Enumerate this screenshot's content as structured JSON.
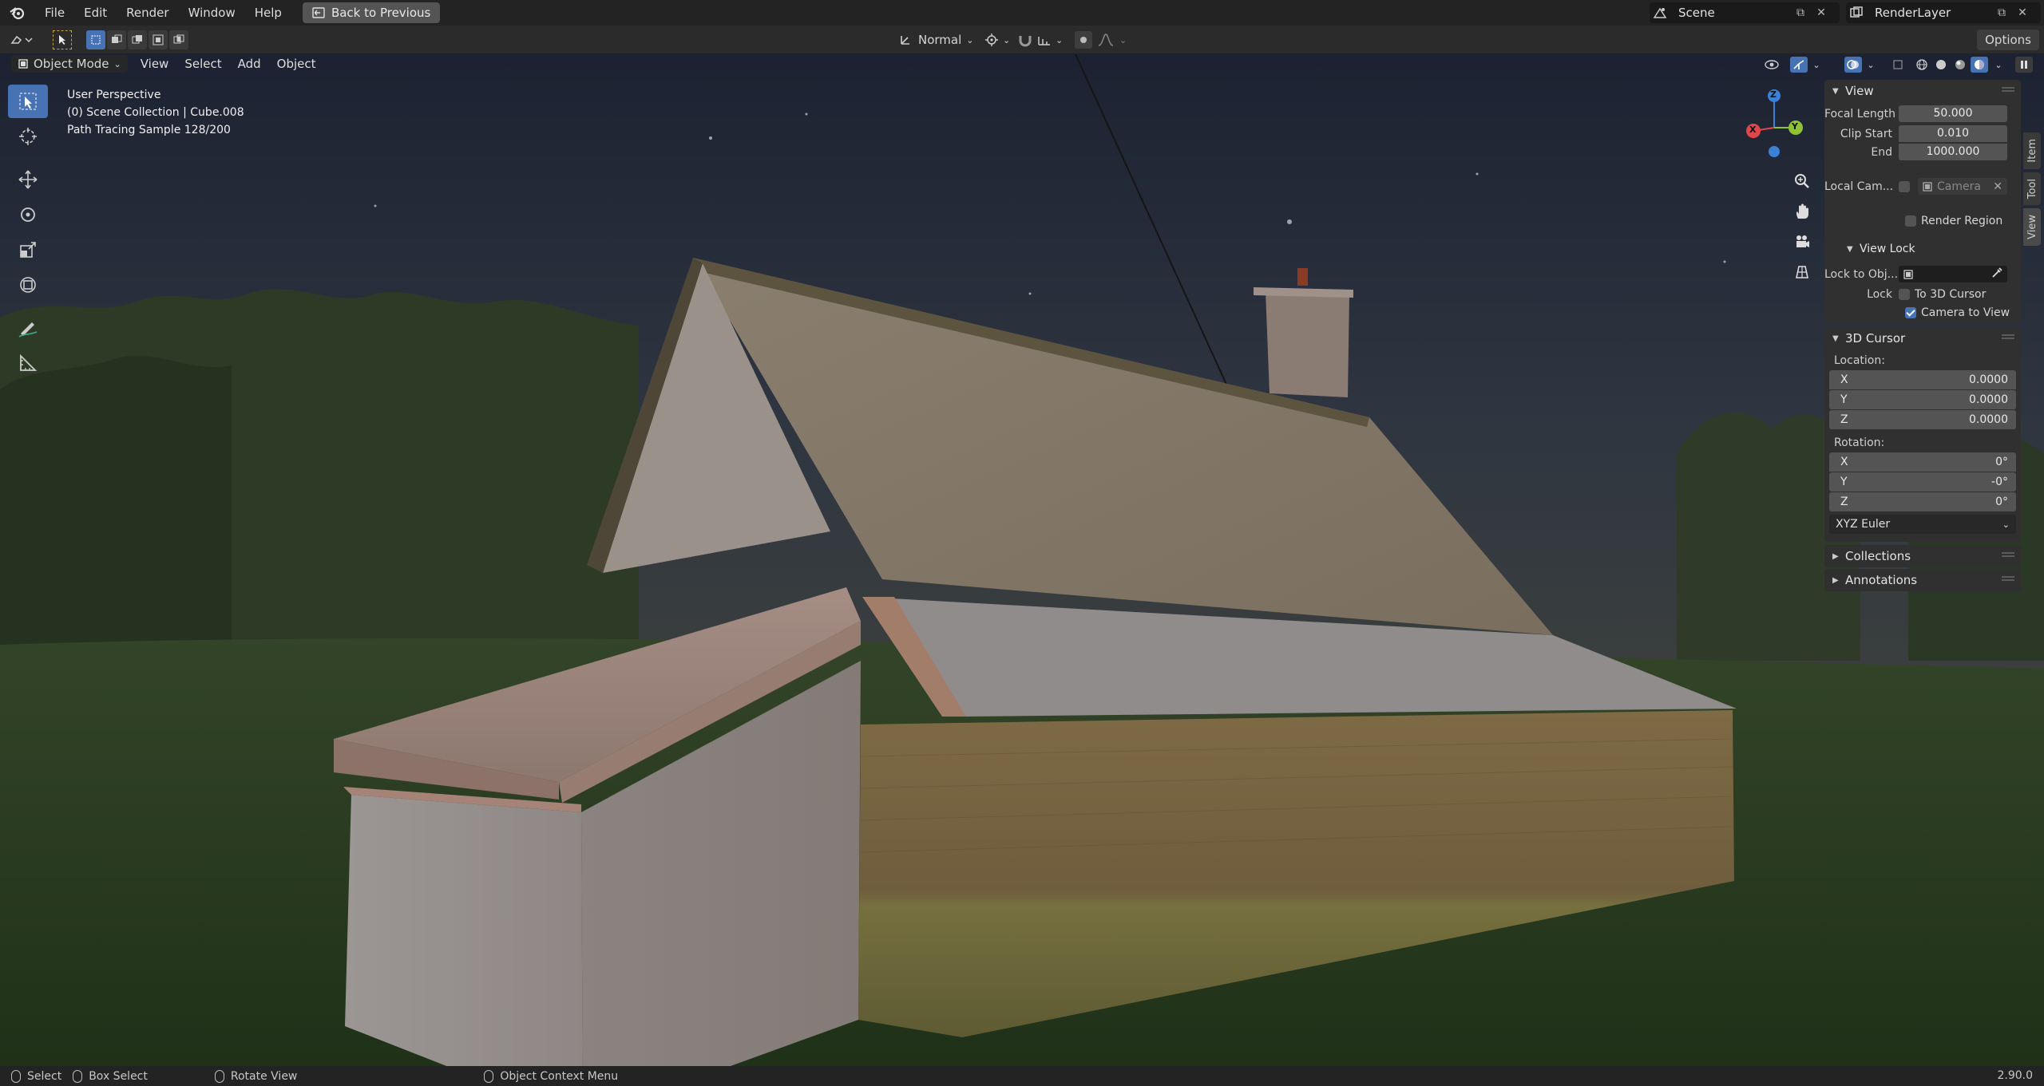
{
  "menubar": {
    "items": [
      "File",
      "Edit",
      "Render",
      "Window",
      "Help"
    ],
    "back_button": "Back to Previous",
    "scene_name": "Scene",
    "view_layer": "RenderLayer"
  },
  "tool_header": {
    "transform_orientation": "Normal",
    "options_label": "Options"
  },
  "viewport_header": {
    "mode": "Object Mode",
    "menus": [
      "View",
      "Select",
      "Add",
      "Object"
    ]
  },
  "overlay": {
    "perspective": "User Perspective",
    "collection": "(0) Scene Collection | Cube.008",
    "render_status": "Path Tracing Sample 128/200"
  },
  "gizmo": {
    "x": "X",
    "y": "Y",
    "z": "Z"
  },
  "npanel": {
    "tabs": [
      "Item",
      "Tool",
      "View"
    ],
    "view": {
      "title": "View",
      "focal_length_label": "Focal Length",
      "focal_length": "50.000",
      "clip_start_label": "Clip Start",
      "clip_start": "0.010",
      "end_label": "End",
      "end": "1000.000",
      "local_camera_label": "Local Cam...",
      "camera_placeholder": "Camera",
      "render_region_label": "Render Region",
      "view_lock_title": "View Lock",
      "lock_to_object_label": "Lock to Obj...",
      "lock_label": "Lock",
      "to_3d_cursor_label": "To 3D Cursor",
      "camera_to_view_label": "Camera to View"
    },
    "cursor": {
      "title": "3D Cursor",
      "location_label": "Location:",
      "location": [
        {
          "axis": "X",
          "value": "0.0000"
        },
        {
          "axis": "Y",
          "value": "0.0000"
        },
        {
          "axis": "Z",
          "value": "0.0000"
        }
      ],
      "rotation_label": "Rotation:",
      "rotation": [
        {
          "axis": "X",
          "value": "0°"
        },
        {
          "axis": "Y",
          "value": "-0°"
        },
        {
          "axis": "Z",
          "value": "0°"
        }
      ],
      "rotation_mode": "XYZ Euler"
    },
    "collections_title": "Collections",
    "annotations_title": "Annotations"
  },
  "statusbar": {
    "select": "Select",
    "box_select": "Box Select",
    "rotate_view": "Rotate View",
    "context_menu": "Object Context Menu",
    "version": "2.90.0"
  },
  "colors": {
    "accent": "#4772b3",
    "axis_x": "#e0474d",
    "axis_y": "#8ec234",
    "axis_z": "#3b82d6"
  }
}
